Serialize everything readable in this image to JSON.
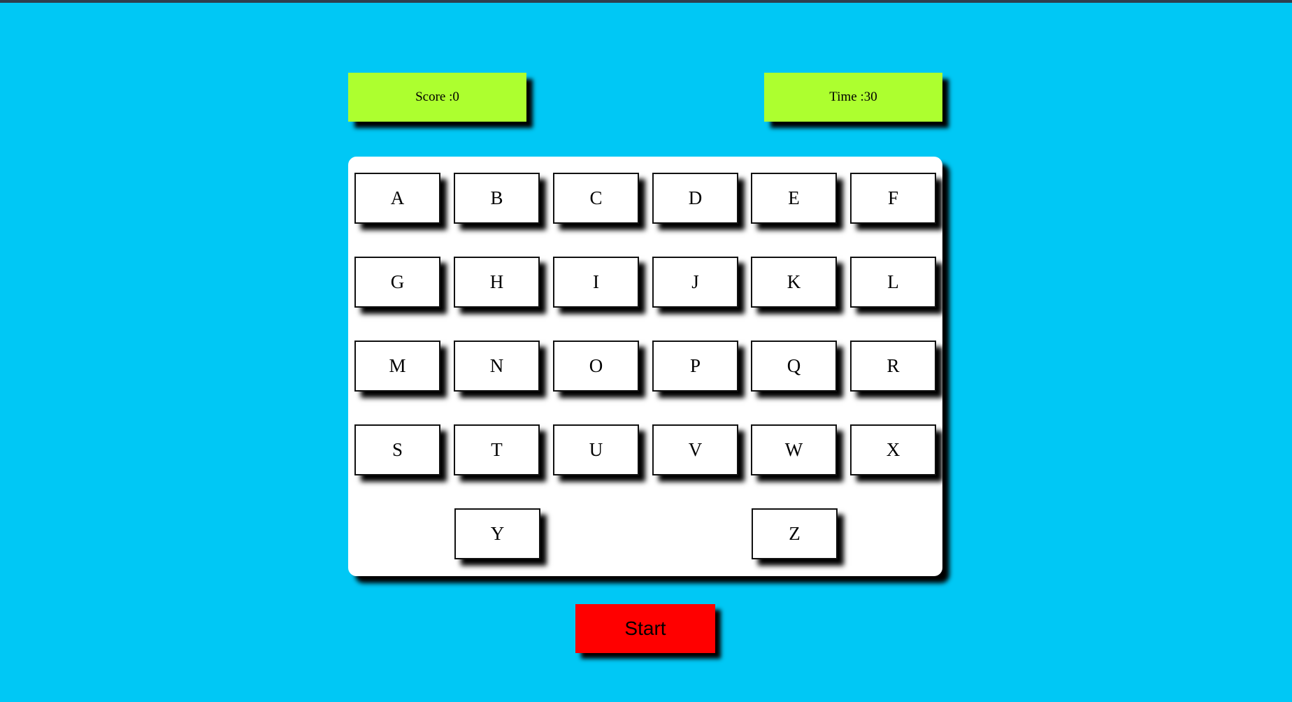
{
  "score": {
    "label": "Score :0"
  },
  "timer": {
    "label": "Time :30"
  },
  "keyboard": {
    "keys": [
      "A",
      "B",
      "C",
      "D",
      "E",
      "F",
      "G",
      "H",
      "I",
      "J",
      "K",
      "L",
      "M",
      "N",
      "O",
      "P",
      "Q",
      "R",
      "S",
      "T",
      "U",
      "V",
      "W",
      "X",
      "Y",
      "Z"
    ]
  },
  "start": {
    "label": "Start"
  },
  "colors": {
    "background": "#00c8f5",
    "stat_box": "#adff2f",
    "board": "#ffffff",
    "start_button": "#ff0000"
  }
}
